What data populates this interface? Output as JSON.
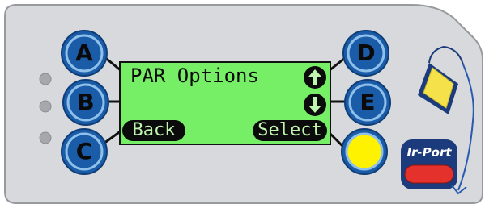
{
  "display": {
    "title": "PAR Options",
    "softkey_left": "Back",
    "softkey_right": "Select",
    "arrow_up_icon": "up-arrow-icon",
    "arrow_down_icon": "down-arrow-icon"
  },
  "buttons": {
    "a": "A",
    "b": "B",
    "c": "C",
    "d": "D",
    "e": "E"
  },
  "ir_port": {
    "label": "Ir-Port"
  },
  "colors": {
    "panel": "#d7d9dc",
    "lcd": "#76ef67",
    "button_blue": "#1a5ca8",
    "button_rim": "#8fc0ea",
    "select_yellow": "#fff200",
    "ir_red": "#e4312b",
    "ir_navy": "#1c3b7c"
  }
}
